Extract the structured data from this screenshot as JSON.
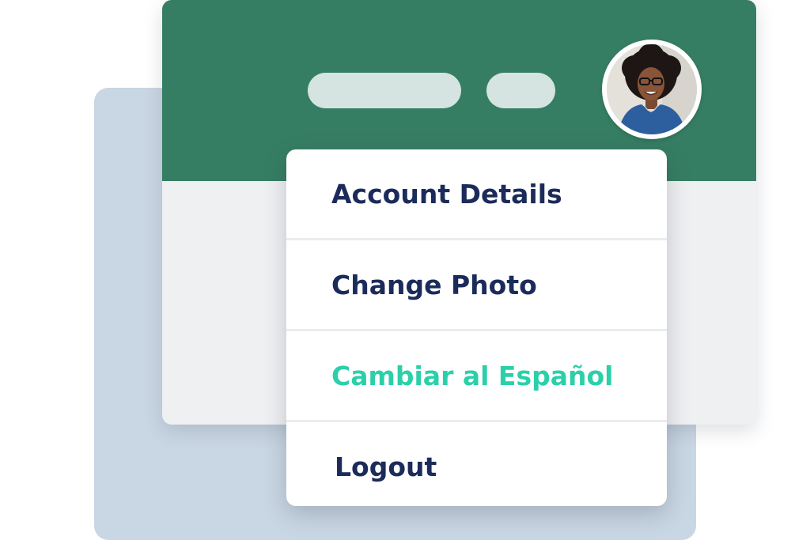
{
  "colors": {
    "header_green": "#367e63",
    "menu_text": "#1b2b5a",
    "accent_text": "#2bd0aa",
    "back_card": "#c9d6e3",
    "window_body": "#eff0f2",
    "nav_pill": "#d5e4e0"
  },
  "header": {
    "nav_items": [
      "nav-placeholder",
      "nav-placeholder"
    ],
    "avatar_icon": "user-avatar"
  },
  "menu": {
    "items": [
      {
        "label": "Account Details"
      },
      {
        "label": "Change Photo"
      },
      {
        "label": "Cambiar al Español",
        "accent": true
      },
      {
        "label": "Logout"
      }
    ]
  }
}
